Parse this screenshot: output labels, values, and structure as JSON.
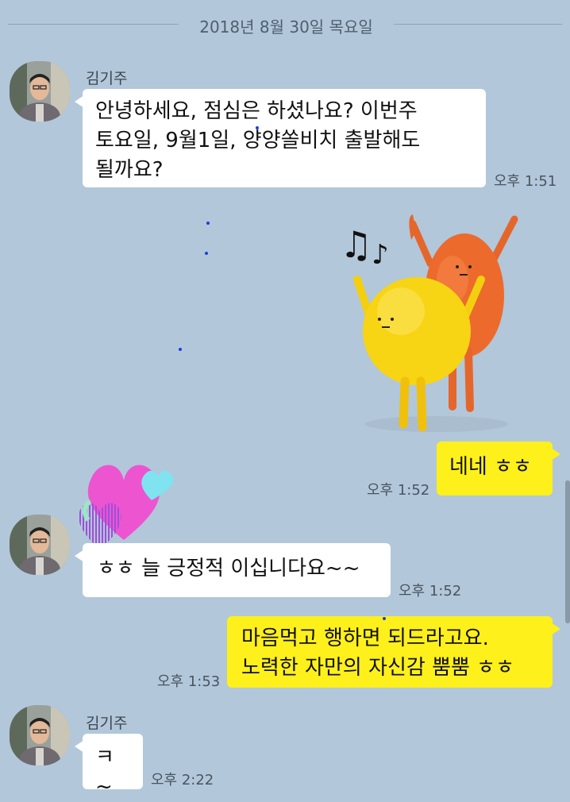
{
  "date_divider": "2018년 8월 30일 목요일",
  "messages": [
    {
      "sender": "김기주",
      "text_lines": [
        "안녕하세요, 점심은 하셨나요? 이번주",
        "토요일, 9월1일, 양양쏠비치 출발해도",
        "될까요?"
      ],
      "time": "오후 1:51"
    },
    {
      "time": "오후 1:52",
      "text": "네네 ㅎㅎ"
    },
    {
      "text": "ㅎㅎ 늘 긍정적 이십니다요~~",
      "time": "오후 1:52"
    },
    {
      "text_lines": [
        "마음먹고 행하면 되드라고요.",
        "노력한 자만의 자신감 뿜뿜 ㅎㅎ"
      ],
      "time": "오후 1:53"
    },
    {
      "sender": "김기주",
      "text": "ㅋ~",
      "time": "오후 2:22"
    }
  ],
  "colors": {
    "background": "#b2c7da",
    "my_bubble": "#fef01b",
    "other_bubble": "#ffffff"
  }
}
